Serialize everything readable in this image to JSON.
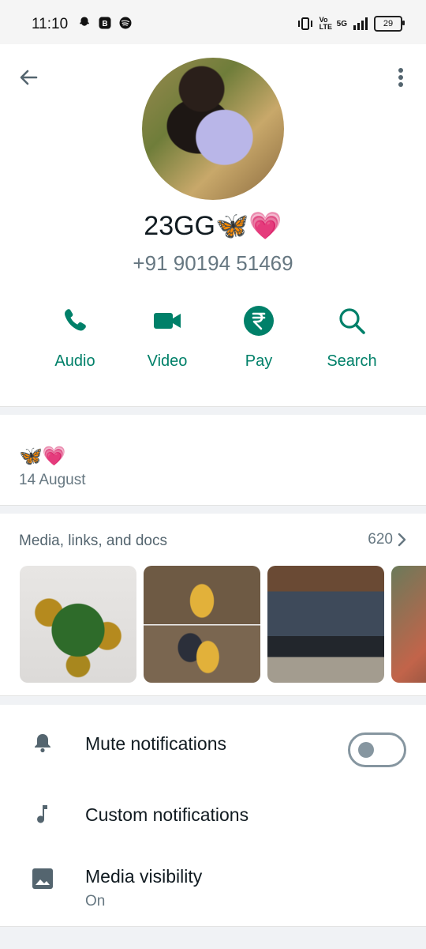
{
  "status_bar": {
    "time": "11:10",
    "network": "5G",
    "battery": "29",
    "volte": "Vo LTE"
  },
  "contact": {
    "name": "23GG🦋💗",
    "phone": "+91 90194 51469"
  },
  "actions": [
    {
      "label": "Audio",
      "icon": "phone-icon"
    },
    {
      "label": "Video",
      "icon": "video-icon"
    },
    {
      "label": "Pay",
      "icon": "rupee-icon"
    },
    {
      "label": "Search",
      "icon": "search-icon"
    }
  ],
  "about": {
    "text": "🦋💗",
    "date": "14 August"
  },
  "media": {
    "title": "Media, links, and docs",
    "count": "620"
  },
  "settings": {
    "mute_label": "Mute notifications",
    "mute_state": "off",
    "custom_label": "Custom notifications",
    "media_visibility_label": "Media visibility",
    "media_visibility_value": "On"
  },
  "colors": {
    "accent": "#008069",
    "secondary_text": "#667781",
    "divider": "#f0f2f5"
  }
}
